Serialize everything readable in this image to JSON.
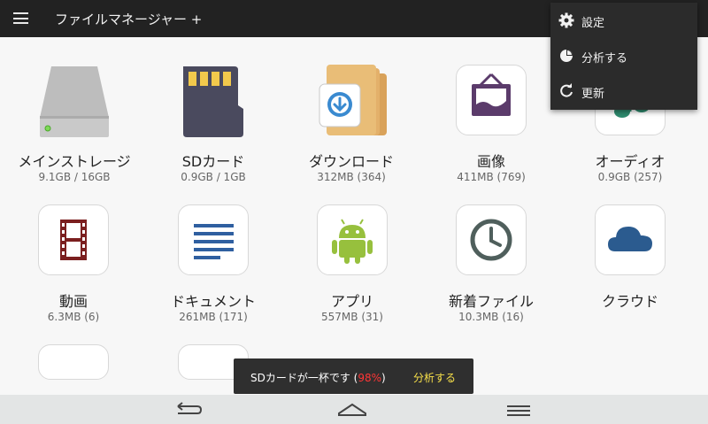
{
  "app": {
    "title": "ファイルマネージャー +"
  },
  "tiles": [
    {
      "name": "メインストレージ",
      "size": "9.1GB / 16GB"
    },
    {
      "name": "SDカード",
      "size": "0.9GB / 1GB"
    },
    {
      "name": "ダウンロード",
      "size": "312MB (364)"
    },
    {
      "name": "画像",
      "size": "411MB (769)"
    },
    {
      "name": "オーディオ",
      "size": "0.9GB (257)"
    },
    {
      "name": "動画",
      "size": "6.3MB (6)"
    },
    {
      "name": "ドキュメント",
      "size": "261MB (171)"
    },
    {
      "name": "アプリ",
      "size": "557MB (31)"
    },
    {
      "name": "新着ファイル",
      "size": "10.3MB (16)"
    },
    {
      "name": "クラウド",
      "size": ""
    }
  ],
  "menu": {
    "items": [
      {
        "label": "設定",
        "icon": "gear-icon"
      },
      {
        "label": "分析する",
        "icon": "pie-chart-icon"
      },
      {
        "label": "更新",
        "icon": "refresh-icon"
      }
    ]
  },
  "toast": {
    "message": "SDカードが一杯です (",
    "percent": "98%",
    "suffix": ")",
    "action": "分析する"
  },
  "colors": {
    "appbar": "#222222",
    "menu_bg": "#2b2b2b",
    "toast_percent": "#ff3535",
    "toast_action": "#f7e04a",
    "navbar": "#e3e5e5"
  }
}
